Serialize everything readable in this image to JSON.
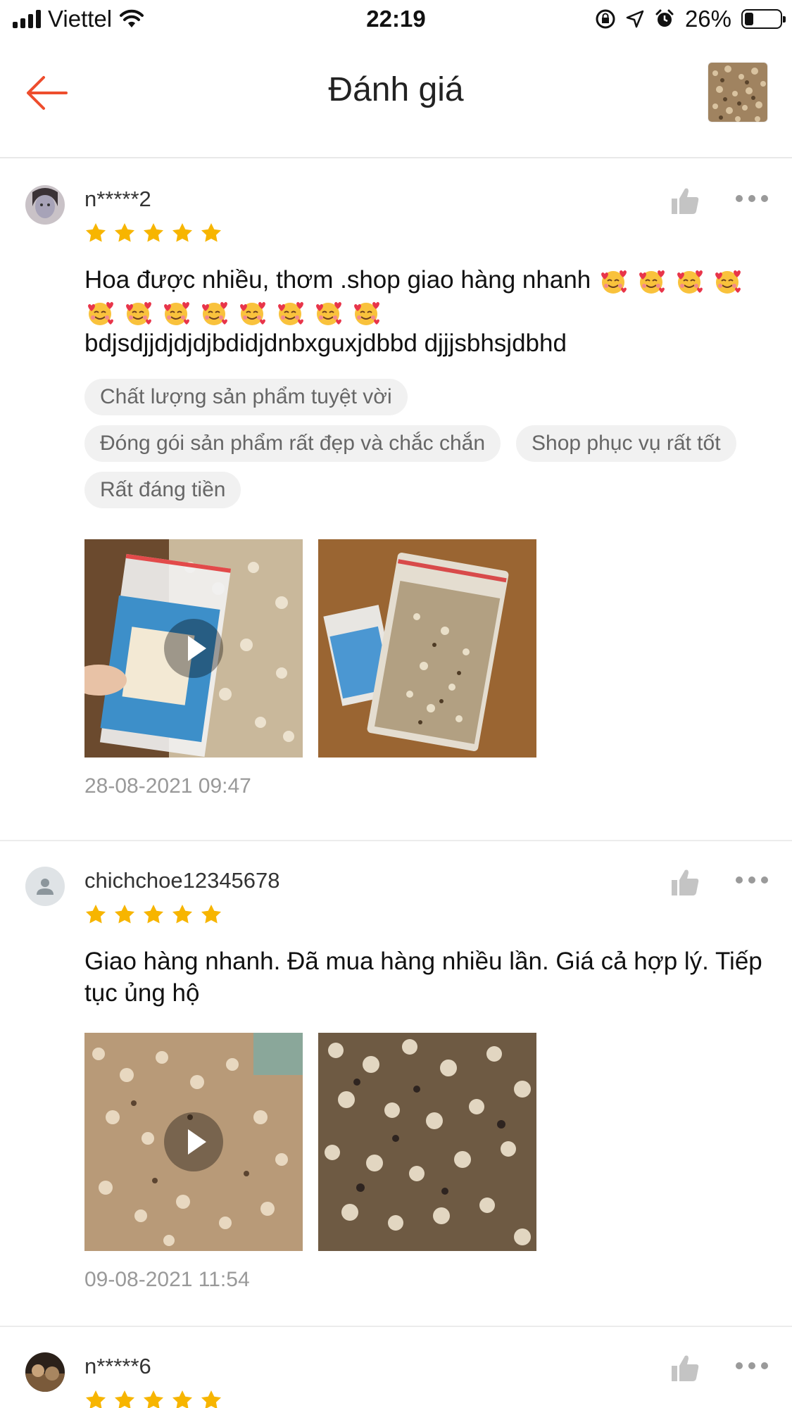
{
  "status_bar": {
    "carrier": "Viettel",
    "time": "22:19",
    "battery": "26%",
    "battery_level": 0.26
  },
  "header": {
    "title": "Đánh giá",
    "back_icon": "arrow-left-icon",
    "accent_color": "#ee4d2d"
  },
  "reviews": [
    {
      "username": "n*****2",
      "rating": 5,
      "text_line1": "Hoa được nhiều, thơm  .shop giao hàng nhanh",
      "emoji_count": 12,
      "text_line2": "bdjsdjjdjdjdjbdidjdnbxguxjdbbd djjjsbhsjdbhd",
      "tags": [
        "Chất lượng sản phẩm tuyệt vời",
        "Đóng gói sản phẩm rất đẹp và chắc chắn",
        "Shop phục vụ rất tốt",
        "Rất đáng tiền"
      ],
      "media_count": 2,
      "date": "28-08-2021 09:47"
    },
    {
      "username": "chichchoe12345678",
      "rating": 5,
      "text": "Giao hàng nhanh. Đã mua hàng nhiều lần. Giá cả hợp lý. Tiếp tục ủng hộ",
      "media_count": 2,
      "date": "09-08-2021 11:54"
    },
    {
      "username": "n*****6",
      "rating": 5
    }
  ],
  "colors": {
    "star": "#f7b500",
    "tag_bg": "#f1f1f1",
    "date": "#999999"
  }
}
